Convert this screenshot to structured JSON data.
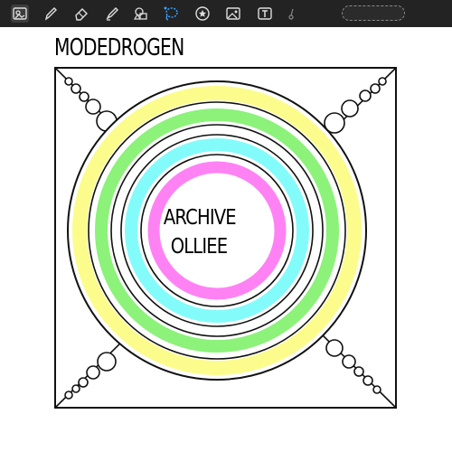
{
  "toolbar": {
    "tools": [
      {
        "name": "gallery-icon",
        "active": true
      },
      {
        "name": "pen-icon"
      },
      {
        "name": "eraser-icon"
      },
      {
        "name": "marker-icon"
      },
      {
        "name": "shapes-icon"
      },
      {
        "name": "lasso-icon"
      },
      {
        "name": "sticker-icon"
      },
      {
        "name": "image-icon"
      },
      {
        "name": "text-icon"
      },
      {
        "name": "more-icon"
      }
    ],
    "search_placeholder": ""
  },
  "canvas": {
    "title": "MODEDROGEN",
    "center_line1": "ARCHIVE",
    "center_line2": "OLLIEE"
  },
  "colors": {
    "toolbar_bg": "#232323",
    "yellow_ring": "#fcfc8c",
    "green_ring": "#8cf27a",
    "cyan_ring": "#84fbfb",
    "pink_ring": "#ff82f5",
    "accent_blue": "#3aa0ff"
  }
}
